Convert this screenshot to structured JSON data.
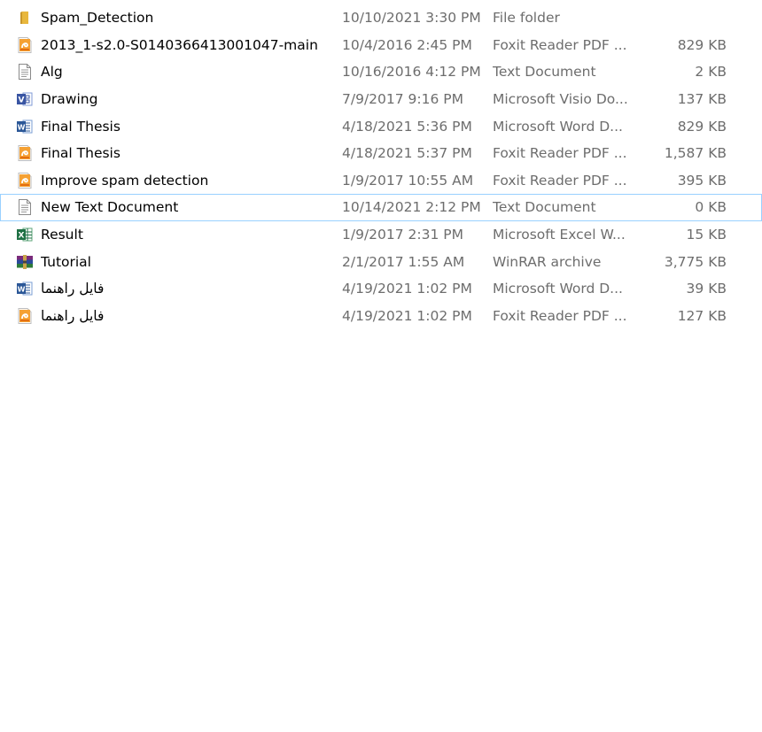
{
  "files": [
    {
      "name": "Spam_Detection",
      "date": "10/10/2021 3:30 PM",
      "type": "File folder",
      "size": "",
      "icon": "folder-icon"
    },
    {
      "name": "2013_1-s2.0-S0140366413001047-main",
      "date": "10/4/2016 2:45 PM",
      "type": "Foxit Reader PDF ...",
      "size": "829 KB",
      "icon": "pdf-icon"
    },
    {
      "name": "Alg",
      "date": "10/16/2016 4:12 PM",
      "type": "Text Document",
      "size": "2 KB",
      "icon": "text-document-icon"
    },
    {
      "name": "Drawing",
      "date": "7/9/2017 9:16 PM",
      "type": "Microsoft Visio Do...",
      "size": "137 KB",
      "icon": "visio-icon"
    },
    {
      "name": "Final Thesis",
      "date": "4/18/2021 5:36 PM",
      "type": "Microsoft Word D...",
      "size": "829 KB",
      "icon": "word-icon"
    },
    {
      "name": "Final Thesis",
      "date": "4/18/2021 5:37 PM",
      "type": "Foxit Reader PDF ...",
      "size": "1,587 KB",
      "icon": "pdf-icon"
    },
    {
      "name": "Improve spam detection",
      "date": "1/9/2017 10:55 AM",
      "type": "Foxit Reader PDF ...",
      "size": "395 KB",
      "icon": "pdf-icon"
    },
    {
      "name": "New Text Document",
      "date": "10/14/2021 2:12 PM",
      "type": "Text Document",
      "size": "0 KB",
      "icon": "text-document-icon",
      "focused": true
    },
    {
      "name": "Result",
      "date": "1/9/2017 2:31 PM",
      "type": "Microsoft Excel W...",
      "size": "15 KB",
      "icon": "excel-icon"
    },
    {
      "name": "Tutorial",
      "date": "2/1/2017 1:55 AM",
      "type": "WinRAR archive",
      "size": "3,775 KB",
      "icon": "winrar-icon"
    },
    {
      "name": "فایل راهنما",
      "date": "4/19/2021 1:02 PM",
      "type": "Microsoft Word D...",
      "size": "39 KB",
      "icon": "word-icon"
    },
    {
      "name": "فایل راهنما",
      "date": "4/19/2021 1:02 PM",
      "type": "Foxit Reader PDF ...",
      "size": "127 KB",
      "icon": "pdf-icon"
    }
  ],
  "colors": {
    "focus_border": "#99d1ff",
    "secondary_text": "#6d6d6d",
    "folder": "#e8b73d",
    "pdf": "#f28c28",
    "word": "#2b5797",
    "excel": "#1f7145",
    "visio": "#3955a3"
  }
}
